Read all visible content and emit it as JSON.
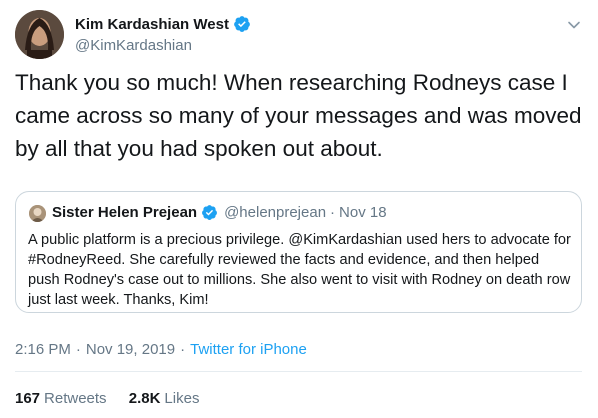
{
  "tweet": {
    "author": {
      "display_name": "Kim Kardashian West",
      "handle": "@KimKardashian",
      "verified": true
    },
    "text": "Thank you so much! When researching Rodneys case I came across so many of your messages and was moved by all that you had spoken out about.",
    "quoted_tweet": {
      "author": {
        "display_name": "Sister Helen Prejean",
        "handle": "@helenprejean",
        "verified": true
      },
      "separator": "·",
      "date": "Nov 18",
      "text": "A public platform is a precious privilege. @KimKardashian used hers to advocate for #RodneyReed. She carefully reviewed the facts and evidence, and then helped push Rodney's case out to millions. She also went to visit with Rodney on death row just last week. Thanks, Kim!"
    },
    "meta": {
      "time": "2:16 PM",
      "date": "Nov 19, 2019",
      "separator": "·",
      "separator2": "·",
      "source": "Twitter for iPhone"
    },
    "stats": {
      "retweets_count": "167",
      "retweets_label": "Retweets",
      "likes_count": "2.8K",
      "likes_label": "Likes"
    }
  },
  "icons": {
    "verified": "verified-badge-icon",
    "menu": "chevron-down-icon"
  },
  "colors": {
    "verified_blue": "#1da1f2",
    "link_blue": "#1da1f2",
    "secondary_text": "#657786",
    "border": "#ccd6dd"
  }
}
